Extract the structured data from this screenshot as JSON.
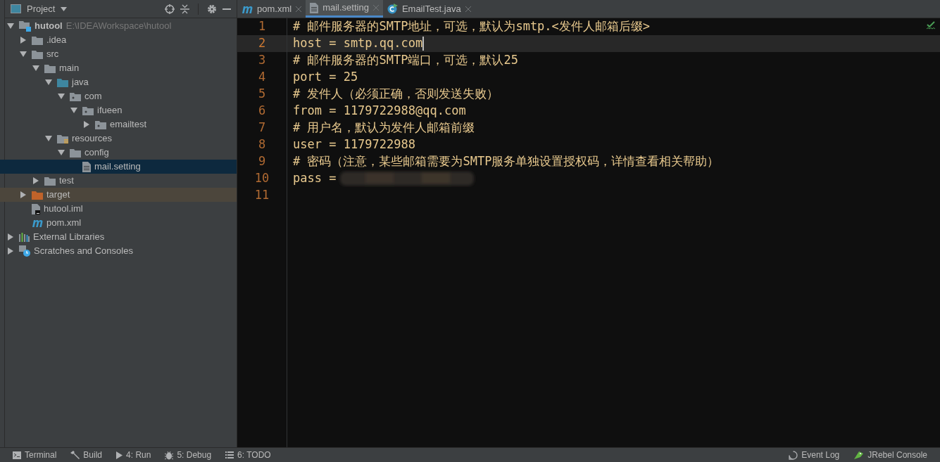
{
  "project_panel": {
    "title": "Project",
    "tree": [
      {
        "label": "hutool",
        "path": "E:\\IDEAWorkspace\\hutool",
        "kind": "module",
        "expanded": true,
        "selected": false,
        "children": [
          {
            "label": ".idea",
            "kind": "folder",
            "expanded": false,
            "selected": false
          },
          {
            "label": "src",
            "kind": "folder",
            "expanded": true,
            "selected": false,
            "children": [
              {
                "label": "main",
                "kind": "folder",
                "expanded": true,
                "selected": false,
                "children": [
                  {
                    "label": "java",
                    "kind": "source",
                    "expanded": true,
                    "selected": false,
                    "children": [
                      {
                        "label": "com",
                        "kind": "package",
                        "expanded": true,
                        "selected": false,
                        "children": [
                          {
                            "label": "ifueen",
                            "kind": "package",
                            "expanded": true,
                            "selected": false,
                            "children": [
                              {
                                "label": "emailtest",
                                "kind": "package",
                                "expanded": false,
                                "selected": false
                              }
                            ]
                          }
                        ]
                      }
                    ]
                  },
                  {
                    "label": "resources",
                    "kind": "resources",
                    "expanded": true,
                    "selected": false,
                    "children": [
                      {
                        "label": "config",
                        "kind": "folder",
                        "expanded": true,
                        "selected": false,
                        "children": [
                          {
                            "label": "mail.setting",
                            "kind": "file",
                            "selected": true
                          }
                        ]
                      }
                    ]
                  }
                ]
              },
              {
                "label": "test",
                "kind": "folder",
                "expanded": false,
                "selected": false
              }
            ]
          },
          {
            "label": "target",
            "kind": "excluded",
            "expanded": false,
            "selected": false
          },
          {
            "label": "hutool.iml",
            "kind": "iml",
            "selected": false
          },
          {
            "label": "pom.xml",
            "kind": "maven",
            "selected": false
          }
        ]
      },
      {
        "label": "External Libraries",
        "kind": "libraries",
        "expanded": false,
        "selected": false
      },
      {
        "label": "Scratches and Consoles",
        "kind": "scratches",
        "expanded": false,
        "selected": false
      }
    ]
  },
  "tabs": [
    {
      "label": "pom.xml",
      "kind": "maven",
      "selected": false
    },
    {
      "label": "mail.setting",
      "kind": "file",
      "selected": true
    },
    {
      "label": "EmailTest.java",
      "kind": "java",
      "selected": false
    }
  ],
  "editor": {
    "lines": [
      {
        "number": "1",
        "text": "# 邮件服务器的SMTP地址，可选，默认为smtp.<发件人邮箱后缀>",
        "current": false
      },
      {
        "number": "2",
        "text": "host = smtp.qq.com",
        "current": true
      },
      {
        "number": "3",
        "text": "# 邮件服务器的SMTP端口，可选，默认25",
        "current": false
      },
      {
        "number": "4",
        "text": "port = 25",
        "current": false
      },
      {
        "number": "5",
        "text": "# 发件人（必须正确，否则发送失败）",
        "current": false
      },
      {
        "number": "6",
        "text": "from = 1179722988@qq.com",
        "current": false
      },
      {
        "number": "7",
        "text": "# 用户名，默认为发件人邮箱前缀",
        "current": false
      },
      {
        "number": "8",
        "text": "user = 1179722988",
        "current": false
      },
      {
        "number": "9",
        "text": "# 密码（注意，某些邮箱需要为SMTP服务单独设置授权码，详情查看相关帮助）",
        "current": false
      },
      {
        "number": "10",
        "text": "pass =",
        "current": false,
        "redacted": true
      },
      {
        "number": "11",
        "current": false
      }
    ]
  },
  "status_bar": {
    "left": [
      {
        "label": "Terminal",
        "kind": "terminal"
      },
      {
        "label": "Build",
        "kind": "build"
      },
      {
        "label": "4: Run",
        "kind": "run"
      },
      {
        "label": "5: Debug",
        "kind": "debug"
      },
      {
        "label": "6: TODO",
        "kind": "todo"
      }
    ],
    "right": [
      {
        "label": "Event Log",
        "kind": "log"
      },
      {
        "label": "JRebel Console",
        "kind": "jrebel"
      }
    ]
  }
}
